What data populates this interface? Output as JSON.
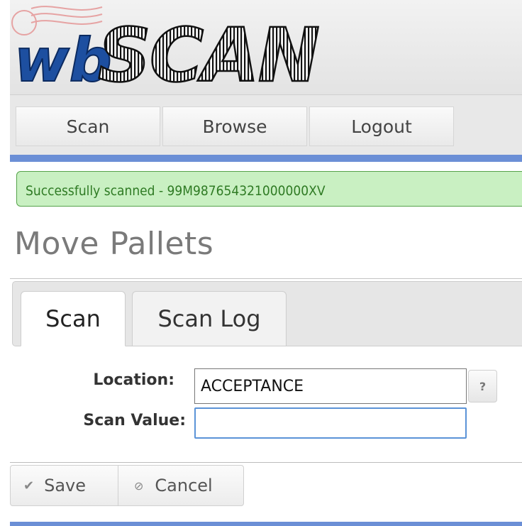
{
  "header": {
    "logo_text_prefix": "wb",
    "logo_text_main": "SCAN"
  },
  "nav": {
    "items": [
      {
        "label": "Scan"
      },
      {
        "label": "Browse"
      },
      {
        "label": "Logout"
      }
    ]
  },
  "message": {
    "success": "Successfully scanned - 99M987654321000000XV"
  },
  "page": {
    "title": "Move Pallets"
  },
  "tabs": [
    {
      "label": "Scan",
      "active": true
    },
    {
      "label": "Scan Log",
      "active": false
    }
  ],
  "form": {
    "location_label": "Location:",
    "location_value": "ACCEPTANCE",
    "help_label": "?",
    "scan_value_label": "Scan Value:",
    "scan_value": ""
  },
  "actions": {
    "save_label": "Save",
    "cancel_label": "Cancel",
    "save_icon": "checkmark-icon",
    "cancel_icon": "prohibited-icon"
  },
  "colors": {
    "accent_bar": "#6b8fd6",
    "success_bg": "#c9f0c2",
    "success_border": "#55a34a",
    "success_text": "#2f7b24",
    "logo_blue": "#1d4fa0",
    "input_focus": "#5b93d7"
  }
}
